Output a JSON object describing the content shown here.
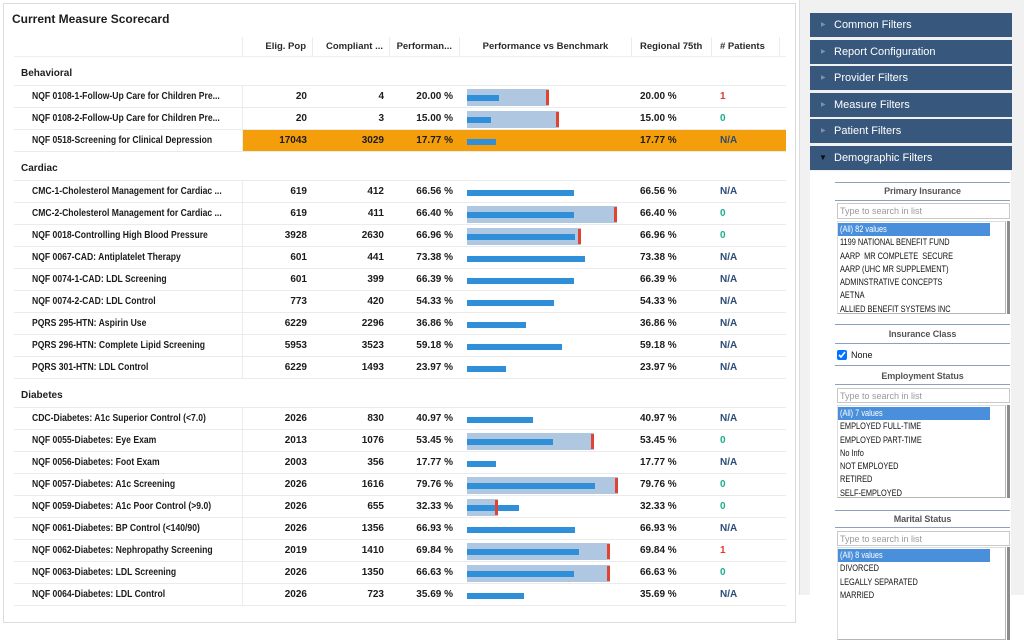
{
  "title": "Current Measure Scorecard",
  "colors": {
    "highlight": "#f59e0b",
    "performance_bar": "#2f8fd8",
    "benchmark_range": "#afc7e0",
    "benchmark_marker": "#e2422f",
    "patients_na": "#2d4c76",
    "patients_ok": "#17b08b",
    "patients_alert": "#e03a2e",
    "filter_header": "#37577d"
  },
  "table": {
    "columns": {
      "measure": "",
      "elig_pop": "Elig. Pop",
      "compliant": "Compliant ...",
      "performance": "Performan...",
      "benchmark": "Performance vs Benchmark",
      "regional": "Regional 75th",
      "patients": "# Patients"
    },
    "groups": [
      {
        "label": "Behavioral",
        "rows": [
          {
            "measure": "NQF 0108-1-Follow-Up Care for Children Pre...",
            "elig_pop": "20",
            "compliant": "4",
            "performance": "20.00 %",
            "performance_pct": 20.0,
            "benchmark_pct": 51,
            "regional_75th": "20.00 %",
            "patients": "1",
            "patients_status": "alert",
            "highlighted": false
          },
          {
            "measure": "NQF 0108-2-Follow-Up Care for Children Pre...",
            "elig_pop": "20",
            "compliant": "3",
            "performance": "15.00 %",
            "performance_pct": 15.0,
            "benchmark_pct": 57,
            "regional_75th": "15.00 %",
            "patients": "0",
            "patients_status": "ok",
            "highlighted": false
          },
          {
            "measure": "NQF 0518-Screening for Clinical Depression",
            "elig_pop": "17043",
            "compliant": "3029",
            "performance": "17.77 %",
            "performance_pct": 17.77,
            "benchmark_pct": null,
            "regional_75th": "17.77 %",
            "patients": "N/A",
            "patients_status": "na",
            "highlighted": true
          }
        ]
      },
      {
        "label": "Cardiac",
        "rows": [
          {
            "measure": "CMC-1-Cholesterol Management for Cardiac ...",
            "elig_pop": "619",
            "compliant": "412",
            "performance": "66.56 %",
            "performance_pct": 66.56,
            "benchmark_pct": null,
            "regional_75th": "66.56 %",
            "patients": "N/A",
            "patients_status": "na",
            "highlighted": false
          },
          {
            "measure": "CMC-2-Cholesterol Management for Cardiac ...",
            "elig_pop": "619",
            "compliant": "411",
            "performance": "66.40 %",
            "performance_pct": 66.4,
            "benchmark_pct": 93,
            "regional_75th": "66.40 %",
            "patients": "0",
            "patients_status": "ok",
            "highlighted": false
          },
          {
            "measure": "NQF 0018-Controlling High Blood Pressure",
            "elig_pop": "3928",
            "compliant": "2630",
            "performance": "66.96 %",
            "performance_pct": 66.96,
            "benchmark_pct": 71,
            "regional_75th": "66.96 %",
            "patients": "0",
            "patients_status": "ok",
            "highlighted": false
          },
          {
            "measure": "NQF 0067-CAD: Antiplatelet Therapy",
            "elig_pop": "601",
            "compliant": "441",
            "performance": "73.38 %",
            "performance_pct": 73.38,
            "benchmark_pct": null,
            "regional_75th": "73.38 %",
            "patients": "N/A",
            "patients_status": "na",
            "highlighted": false
          },
          {
            "measure": "NQF 0074-1-CAD: LDL Screening",
            "elig_pop": "601",
            "compliant": "399",
            "performance": "66.39 %",
            "performance_pct": 66.39,
            "benchmark_pct": null,
            "regional_75th": "66.39 %",
            "patients": "N/A",
            "patients_status": "na",
            "highlighted": false
          },
          {
            "measure": "NQF 0074-2-CAD: LDL Control",
            "elig_pop": "773",
            "compliant": "420",
            "performance": "54.33 %",
            "performance_pct": 54.33,
            "benchmark_pct": null,
            "regional_75th": "54.33 %",
            "patients": "N/A",
            "patients_status": "na",
            "highlighted": false
          },
          {
            "measure": "PQRS 295-HTN: Aspirin Use",
            "elig_pop": "6229",
            "compliant": "2296",
            "performance": "36.86 %",
            "performance_pct": 36.86,
            "benchmark_pct": null,
            "regional_75th": "36.86 %",
            "patients": "N/A",
            "patients_status": "na",
            "highlighted": false
          },
          {
            "measure": "PQRS 296-HTN: Complete Lipid Screening",
            "elig_pop": "5953",
            "compliant": "3523",
            "performance": "59.18 %",
            "performance_pct": 59.18,
            "benchmark_pct": null,
            "regional_75th": "59.18 %",
            "patients": "N/A",
            "patients_status": "na",
            "highlighted": false
          },
          {
            "measure": "PQRS 301-HTN: LDL Control",
            "elig_pop": "6229",
            "compliant": "1493",
            "performance": "23.97 %",
            "performance_pct": 23.97,
            "benchmark_pct": null,
            "regional_75th": "23.97 %",
            "patients": "N/A",
            "patients_status": "na",
            "highlighted": false
          }
        ]
      },
      {
        "label": "Diabetes",
        "rows": [
          {
            "measure": "CDC-Diabetes: A1c Superior Control (<7.0)",
            "elig_pop": "2026",
            "compliant": "830",
            "performance": "40.97 %",
            "performance_pct": 40.97,
            "benchmark_pct": null,
            "regional_75th": "40.97 %",
            "patients": "N/A",
            "patients_status": "na",
            "highlighted": false
          },
          {
            "measure": "NQF 0055-Diabetes: Eye Exam",
            "elig_pop": "2013",
            "compliant": "1076",
            "performance": "53.45 %",
            "performance_pct": 53.45,
            "benchmark_pct": 79,
            "regional_75th": "53.45 %",
            "patients": "0",
            "patients_status": "ok",
            "highlighted": false
          },
          {
            "measure": "NQF 0056-Diabetes: Foot Exam",
            "elig_pop": "2003",
            "compliant": "356",
            "performance": "17.77 %",
            "performance_pct": 17.77,
            "benchmark_pct": null,
            "regional_75th": "17.77 %",
            "patients": "N/A",
            "patients_status": "na",
            "highlighted": false
          },
          {
            "measure": "NQF 0057-Diabetes: A1c Screening",
            "elig_pop": "2026",
            "compliant": "1616",
            "performance": "79.76 %",
            "performance_pct": 79.76,
            "benchmark_pct": 94,
            "regional_75th": "79.76 %",
            "patients": "0",
            "patients_status": "ok",
            "highlighted": false
          },
          {
            "measure": "NQF 0059-Diabetes: A1c Poor Control (>9.0)",
            "elig_pop": "2026",
            "compliant": "655",
            "performance": "32.33 %",
            "performance_pct": 32.33,
            "benchmark_pct": 19,
            "regional_75th": "32.33 %",
            "patients": "0",
            "patients_status": "ok",
            "highlighted": false
          },
          {
            "measure": "NQF 0061-Diabetes: BP Control (<140/90)",
            "elig_pop": "2026",
            "compliant": "1356",
            "performance": "66.93 %",
            "performance_pct": 66.93,
            "benchmark_pct": null,
            "regional_75th": "66.93 %",
            "patients": "N/A",
            "patients_status": "na",
            "highlighted": false
          },
          {
            "measure": "NQF 0062-Diabetes: Nephropathy Screening",
            "elig_pop": "2019",
            "compliant": "1410",
            "performance": "69.84 %",
            "performance_pct": 69.84,
            "benchmark_pct": 89,
            "regional_75th": "69.84 %",
            "patients": "1",
            "patients_status": "alert",
            "highlighted": false
          },
          {
            "measure": "NQF 0063-Diabetes: LDL Screening",
            "elig_pop": "2026",
            "compliant": "1350",
            "performance": "66.63 %",
            "performance_pct": 66.63,
            "benchmark_pct": 89,
            "regional_75th": "66.63 %",
            "patients": "0",
            "patients_status": "ok",
            "highlighted": false
          },
          {
            "measure": "NQF 0064-Diabetes: LDL Control",
            "elig_pop": "2026",
            "compliant": "723",
            "performance": "35.69 %",
            "performance_pct": 35.69,
            "benchmark_pct": null,
            "regional_75th": "35.69 %",
            "patients": "N/A",
            "patients_status": "na",
            "highlighted": false
          }
        ]
      }
    ]
  },
  "filters": {
    "sections": [
      {
        "label": "Common Filters",
        "expanded": false
      },
      {
        "label": "Report Configuration",
        "expanded": false
      },
      {
        "label": "Provider Filters",
        "expanded": false
      },
      {
        "label": "Measure Filters",
        "expanded": false
      },
      {
        "label": "Patient Filters",
        "expanded": false
      },
      {
        "label": "Demographic Filters",
        "expanded": true
      }
    ],
    "demographic": {
      "primary_insurance": {
        "title": "Primary Insurance",
        "search_placeholder": "Type to search in list",
        "items": [
          "(All) 82 values",
          "1199 NATIONAL BENEFIT FUND",
          "AARP  MR COMPLETE  SECURE",
          "AARP (UHC MR SUPPLEMENT)",
          "ADMINSTRATIVE CONCEPTS",
          "AETNA",
          "ALLIED BENEFIT SYSTEMS INC"
        ],
        "selected_item": "(All) 82 values"
      },
      "insurance_class": {
        "title": "Insurance Class",
        "checkbox_label": "None",
        "checked": true
      },
      "employment_status": {
        "title": "Employment Status",
        "search_placeholder": "Type to search in list",
        "items": [
          "(All) 7 values",
          "EMPLOYED FULL-TIME",
          "EMPLOYED PART-TIME",
          "No Info",
          "NOT EMPLOYED",
          "RETIRED",
          "SELF-EMPLOYED"
        ],
        "selected_item": "(All) 7 values"
      },
      "marital_status": {
        "title": "Marital Status",
        "search_placeholder": "Type to search in list",
        "items": [
          "(All) 8 values",
          "DIVORCED",
          "LEGALLY SEPARATED",
          "MARRIED"
        ],
        "selected_item": "(All) 8 values"
      }
    }
  }
}
